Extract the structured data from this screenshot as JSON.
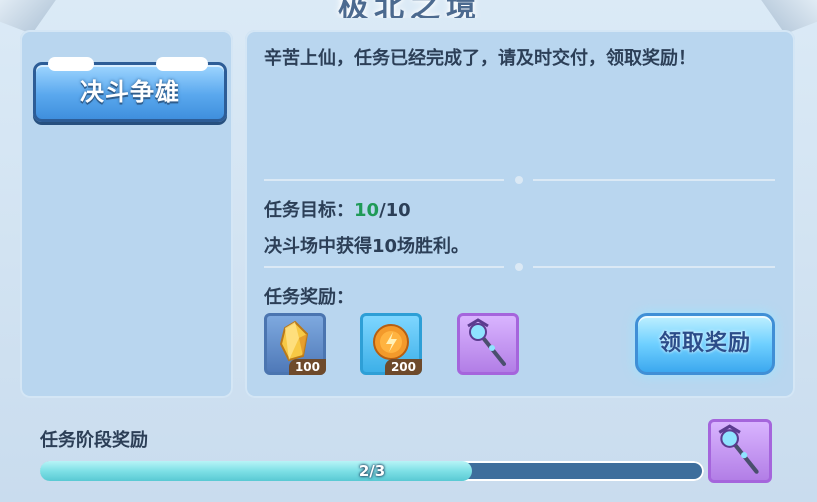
{
  "title": "极北之境",
  "tab": {
    "label": "决斗争雄"
  },
  "dialog": {
    "text": "辛苦上仙，任务已经完成了，请及时交付，领取奖励！"
  },
  "goal": {
    "label": "任务目标：",
    "current": "10",
    "separator": "/",
    "total": "10"
  },
  "description": "决斗场中获得10场胜利。",
  "rewards": {
    "label": "任务奖励：",
    "items": [
      {
        "icon": "gold-crystal-icon",
        "quantity": "100"
      },
      {
        "icon": "gold-coin-icon",
        "quantity": "200"
      },
      {
        "icon": "magic-staff-icon"
      }
    ]
  },
  "claim_button": {
    "label": "领取奖励"
  },
  "stage": {
    "label": "任务阶段奖励",
    "progress_text": "2/3",
    "progress_fraction": 0.651,
    "reward_icon": "magic-staff-icon"
  },
  "colors": {
    "panel": "#b9d6ef",
    "text": "#2c3f57",
    "goal_done": "#1f9a57",
    "progress_fill": "#7ee0e6",
    "progress_track": "#3e6e9c",
    "button_blue": "#5aa8ee"
  }
}
